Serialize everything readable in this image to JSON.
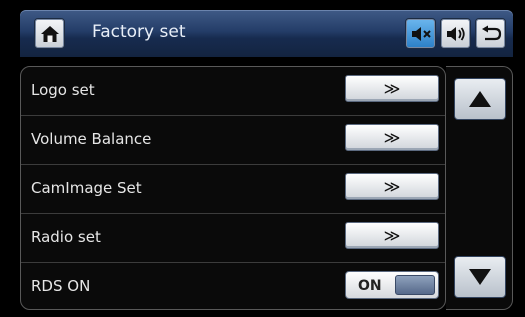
{
  "header": {
    "title": "Factory set",
    "icons": {
      "home": "home-icon",
      "mute": "mute-icon",
      "volume": "volume-icon",
      "back": "back-icon"
    },
    "active_color": "#2b7fc7"
  },
  "rows": [
    {
      "label": "Logo set",
      "control": "arrow",
      "button_label": "≫"
    },
    {
      "label": "Volume Balance",
      "control": "arrow",
      "button_label": "≫"
    },
    {
      "label": "CamImage Set",
      "control": "arrow",
      "button_label": "≫"
    },
    {
      "label": "Radio set",
      "control": "arrow",
      "button_label": "≫"
    },
    {
      "label": "RDS ON",
      "control": "toggle",
      "button_label": "ON"
    }
  ],
  "scroll": {
    "up": "scroll-up-icon",
    "down": "scroll-down-icon"
  }
}
